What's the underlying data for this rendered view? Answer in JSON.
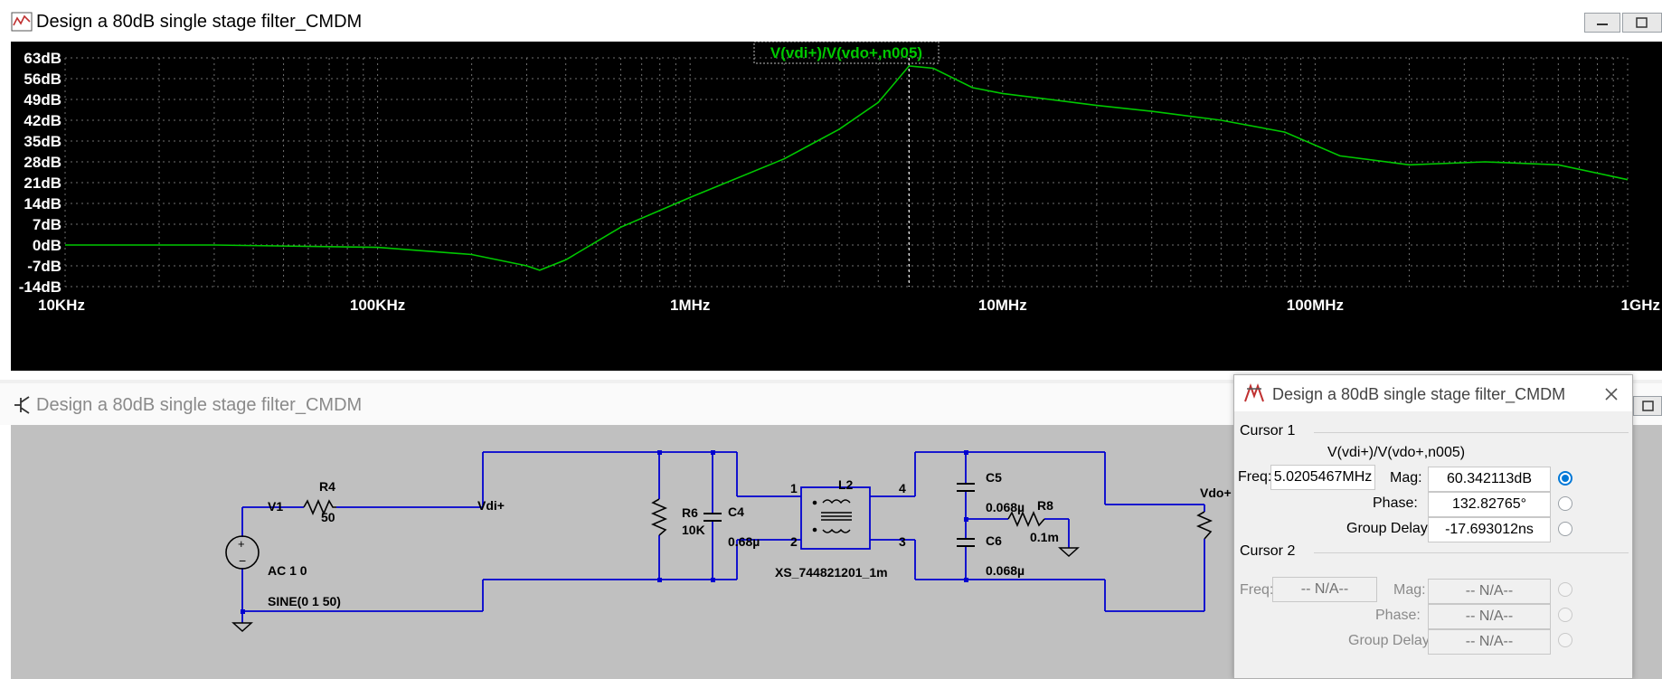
{
  "plot_window": {
    "title": "Design a 80dB single stage filter_CMDM",
    "trace_label": "V(vdi+)/V(vdo+,n005)",
    "y_ticks": [
      "63dB",
      "56dB",
      "49dB",
      "42dB",
      "35dB",
      "28dB",
      "21dB",
      "14dB",
      "7dB",
      "0dB",
      "-7dB",
      "-14dB"
    ],
    "x_ticks": [
      "10KHz",
      "100KHz",
      "1MHz",
      "10MHz",
      "100MHz",
      "1GHz"
    ],
    "trace_color": "#00c800",
    "background": "#000000"
  },
  "chart_data": {
    "type": "line",
    "title": "V(vdi+)/V(vdo+,n005)",
    "xlabel": "",
    "ylabel": "",
    "x_scale": "log",
    "xlim": [
      10000,
      1000000000
    ],
    "ylim": [
      -14,
      63
    ],
    "grid": true,
    "cursor_x": 5020546.7,
    "series": [
      {
        "name": "V(vdi+)/V(vdo+,n005)",
        "x": [
          10000,
          30000,
          100000,
          200000,
          300000,
          330000,
          400000,
          600000,
          1000000,
          2000000,
          3000000,
          4000000,
          5020547,
          6000000,
          8000000,
          10000000,
          20000000,
          30000000,
          50000000,
          80000000,
          120000000,
          200000000,
          350000000,
          600000000,
          1000000000
        ],
        "values": [
          0,
          0,
          -0.8,
          -3.2,
          -7,
          -8.5,
          -5,
          6,
          16,
          29,
          39,
          48,
          60.3,
          59.5,
          53,
          51,
          47,
          45,
          42,
          38,
          30,
          27,
          28,
          27,
          22
        ]
      }
    ]
  },
  "schematic_window": {
    "title": "Design a 80dB single stage filter_CMDM",
    "components": {
      "V1": "V1",
      "R4": "R4",
      "R4_val": "50",
      "R6": "R6",
      "R6_val": "10K",
      "C4": "C4",
      "C4_val": "0.68µ",
      "L2": "L2",
      "XS": "XS_744821201_1m",
      "C5": "C5",
      "C5_val": "0.068µ",
      "C6": "C6",
      "C6_val": "0.068µ",
      "R8": "R8",
      "R8_val": "0.1m",
      "AC": "AC 1 0",
      "SINE": "SINE(0 1 50)",
      "pin1": "1",
      "pin2": "2",
      "pin3": "3",
      "pin4": "4"
    },
    "nets": {
      "vdi": "Vdi+",
      "vdo": "Vdo+"
    }
  },
  "cursor_window": {
    "title": "Design a 80dB single stage filter_CMDM",
    "cursor1": {
      "header": "Cursor 1",
      "trace": "V(vdi+)/V(vdo+,n005)",
      "freq_label": "Freq:",
      "freq": "5.0205467MHz",
      "mag_label": "Mag:",
      "mag": "60.342113dB",
      "phase_label": "Phase:",
      "phase": "132.82765°",
      "gd_label": "Group Delay:",
      "gd": "-17.693012ns"
    },
    "cursor2": {
      "header": "Cursor 2",
      "freq_label": "Freq:",
      "freq": "-- N/A--",
      "mag_label": "Mag:",
      "mag": "-- N/A--",
      "phase_label": "Phase:",
      "phase": "-- N/A--",
      "gd_label": "Group Delay:",
      "gd": "-- N/A--"
    }
  }
}
